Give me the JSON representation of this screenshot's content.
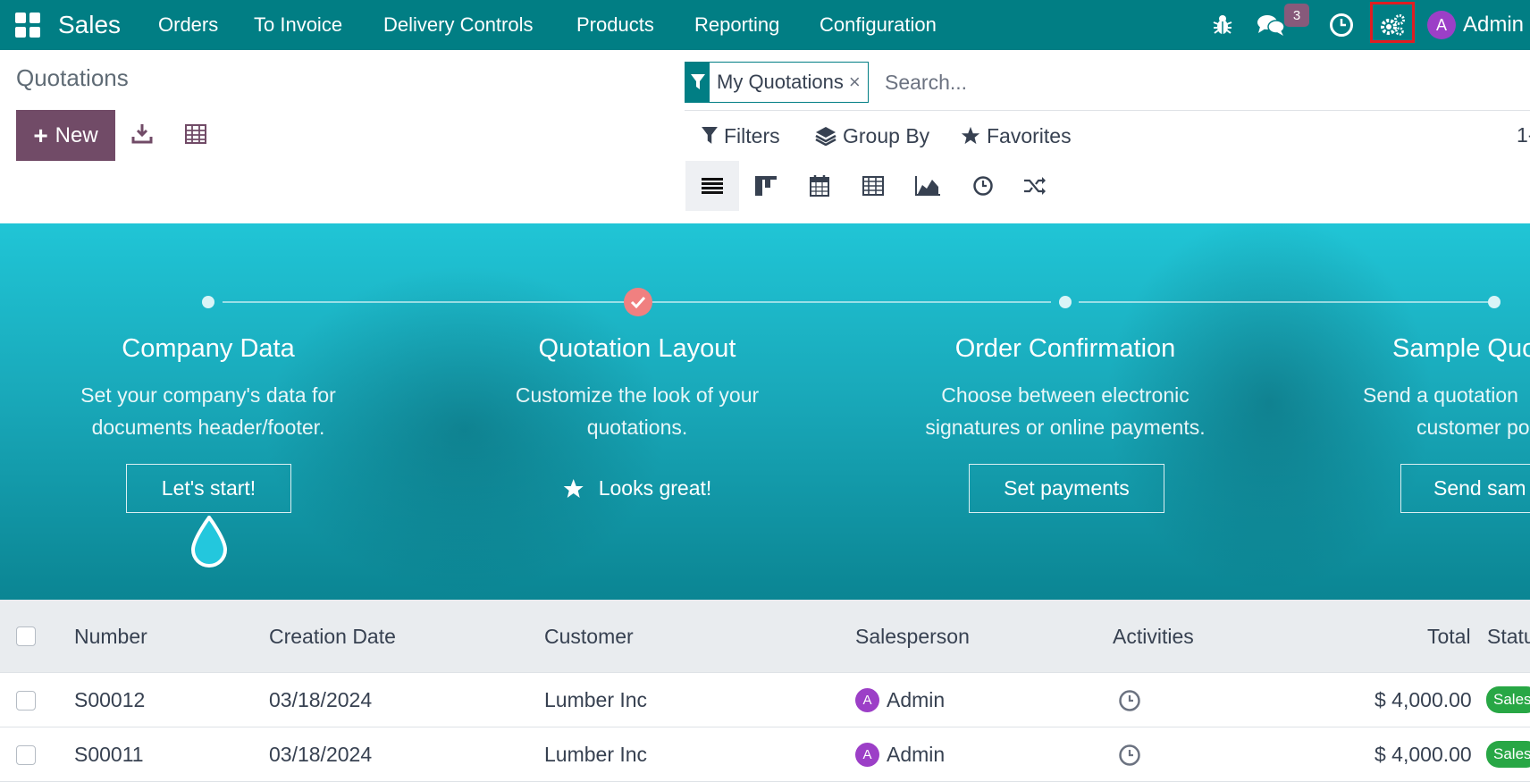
{
  "topbar": {
    "app_name": "Sales",
    "menu": [
      "Orders",
      "To Invoice",
      "Delivery Controls",
      "Products",
      "Reporting",
      "Configuration"
    ],
    "messages_badge": "3",
    "user_initial": "A",
    "user_name": "Admin",
    "icons": [
      "apps-grid-icon",
      "bug-icon",
      "chat-icon",
      "clock-icon",
      "gears-icon"
    ]
  },
  "page": {
    "title": "Quotations",
    "new_label": "New"
  },
  "search": {
    "facet_label": "My Quotations",
    "facet_close": "×",
    "placeholder": "Search...",
    "filters_label": "Filters",
    "groupby_label": "Group By",
    "favorites_label": "Favorites",
    "pager_text": "1-"
  },
  "views": [
    "list",
    "kanban",
    "calendar",
    "pivot",
    "graph",
    "activity",
    "map"
  ],
  "onboarding": {
    "steps": [
      {
        "title": "Company Data",
        "desc1": "Set your company's data for",
        "desc2": "documents header/footer.",
        "button": "Let's start!",
        "done": false
      },
      {
        "title": "Quotation Layout",
        "desc1": "Customize the look of your",
        "desc2": "quotations.",
        "button": "Looks great!",
        "done": true
      },
      {
        "title": "Order Confirmation",
        "desc1": "Choose between electronic",
        "desc2": "signatures or online payments.",
        "button": "Set payments",
        "done": false
      },
      {
        "title": "Sample Quo",
        "desc1": "Send a quotation",
        "desc2": "customer po",
        "button": "Send sam",
        "done": false
      }
    ]
  },
  "table": {
    "headers": {
      "number": "Number",
      "creation_date": "Creation Date",
      "customer": "Customer",
      "salesperson": "Salesperson",
      "activities": "Activities",
      "total": "Total",
      "status": "Statu"
    },
    "rows": [
      {
        "number": "S00012",
        "creation_date": "03/18/2024",
        "customer": "Lumber Inc",
        "salesperson_initial": "A",
        "salesperson": "Admin",
        "total": "$ 4,000.00",
        "status": "Sales"
      },
      {
        "number": "S00011",
        "creation_date": "03/18/2024",
        "customer": "Lumber Inc",
        "salesperson_initial": "A",
        "salesperson": "Admin",
        "total": "$ 4,000.00",
        "status": "Sales"
      }
    ]
  },
  "colors": {
    "brand": "#017e84",
    "primary": "#714b67",
    "avatar": "#9c3fc7",
    "status": "#28a745"
  }
}
